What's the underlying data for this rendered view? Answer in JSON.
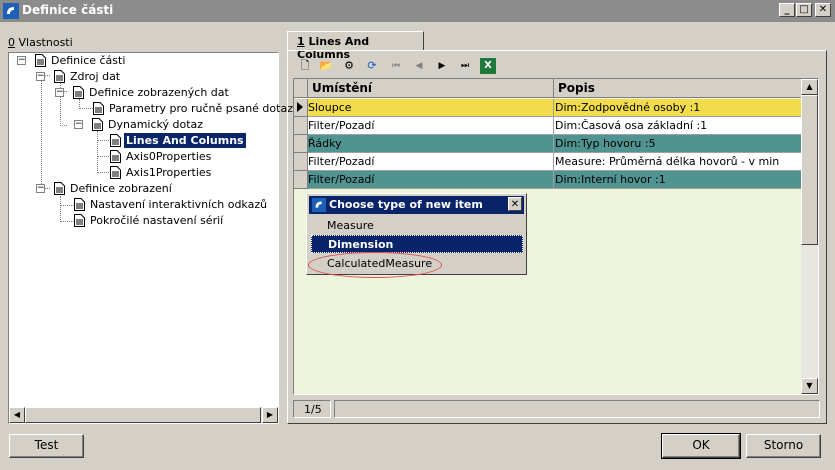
{
  "window": {
    "title": "Definice části"
  },
  "left": {
    "label_key": "0",
    "label_rest": " Vlastnosti",
    "tree": [
      {
        "label": "Definice části",
        "expander": "−"
      },
      {
        "label": "Zdroj dat",
        "expander": "−"
      },
      {
        "label": "Definice zobrazených dat",
        "expander": "−"
      },
      {
        "label": "Parametry pro ručně psané dotazy"
      },
      {
        "label": "Dynamický dotaz",
        "expander": "−"
      },
      {
        "label": "Lines And Columns",
        "selected": true
      },
      {
        "label": "Axis0Properties"
      },
      {
        "label": "Axis1Properties"
      },
      {
        "label": "Definice zobrazení",
        "expander": "−"
      },
      {
        "label": "Nastavení interaktivních odkazů"
      },
      {
        "label": "Pokročilé nastavení sérií"
      }
    ]
  },
  "tab": {
    "key": "1",
    "rest": " Lines And Columns"
  },
  "toolbar": {
    "icons": [
      "new-icon",
      "open-icon",
      "settings-icon",
      "refresh-icon",
      "first-icon",
      "previous-icon",
      "next-icon",
      "last-icon",
      "excel-icon"
    ],
    "glyphs": [
      "🗋",
      "📂",
      "⚙",
      "⟳",
      "⏮",
      "◀",
      "▶",
      "⏭",
      "X"
    ]
  },
  "grid": {
    "columns": [
      "Umístění",
      "Popis"
    ],
    "rows": [
      {
        "placement": "Sloupce",
        "description": "Dim:Zodpovědné osoby :1",
        "color": "#f2dc4e",
        "current": true
      },
      {
        "placement": "Filter/Pozadí",
        "description": "Dim:Časová osa základní :1",
        "color": "#ffffff"
      },
      {
        "placement": "Řádky",
        "description": "Dim:Typ hovoru :5",
        "color": "#4f9490"
      },
      {
        "placement": "Filter/Pozadí",
        "description": "Measure: Průměrná délka hovorů - v min",
        "color": "#ffffff"
      },
      {
        "placement": "Filter/Pozadí",
        "description": "Dim:Interní hovor :1",
        "color": "#4f9490"
      }
    ],
    "empty_color": "#ecf5dc"
  },
  "popup": {
    "title": "Choose type of new item",
    "close": "✕",
    "items": [
      "Measure",
      "Dimension",
      "CalculatedMeasure"
    ],
    "selected": "Dimension"
  },
  "status": {
    "record": "1/5"
  },
  "buttons": {
    "test": "Test",
    "ok": "OK",
    "cancel": "Storno"
  },
  "colors": {
    "selection": "#0a246a",
    "face": "#d4d0c8"
  }
}
